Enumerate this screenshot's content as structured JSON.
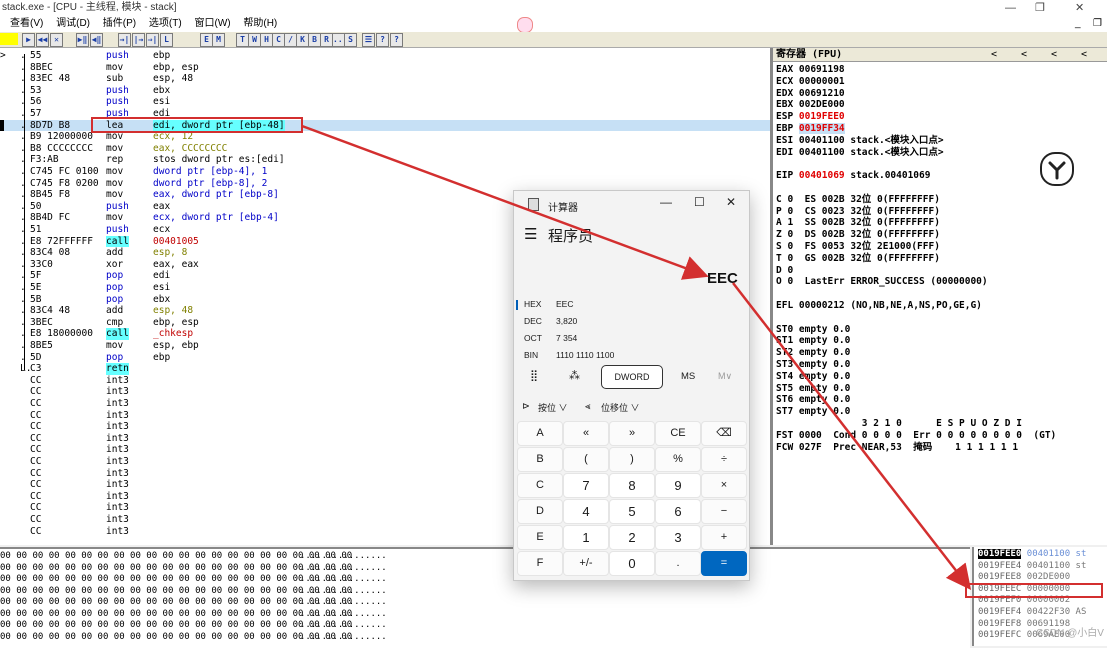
{
  "window": {
    "title": "stack.exe - [CPU - 主线程, 模块 - stack]",
    "controls": [
      "—",
      "❐",
      "✕"
    ],
    "inner_controls": [
      "_",
      "❐"
    ]
  },
  "menu": [
    "查看(V)",
    "调试(D)",
    "插件(P)",
    "选项(T)",
    "窗口(W)",
    "帮助(H)"
  ],
  "toolbar": {
    "buttons": [
      "▶",
      "◀◀",
      "✕",
      "▶‖",
      "◀‖",
      "→|",
      "|→",
      "⇒|",
      "L",
      "E",
      "M",
      "T",
      "W",
      "H",
      "C",
      "/",
      "K",
      "B",
      "R",
      "...",
      "S",
      "☰",
      "?",
      "?"
    ]
  },
  "disasm": [
    {
      "addr": ">",
      "dot": ".",
      "hex": "55",
      "mn": "push",
      "op": "ebp"
    },
    {
      "addr": "",
      "dot": ".",
      "hex": "8BEC",
      "mn": "mov",
      "op": "ebp, esp"
    },
    {
      "addr": "",
      "dot": ".",
      "hex": "83EC 48",
      "mn": "sub",
      "op": "esp, 48"
    },
    {
      "addr": "",
      "dot": ".",
      "hex": "53",
      "mn": "push",
      "op": "ebx"
    },
    {
      "addr": "",
      "dot": ".",
      "hex": "56",
      "mn": "push",
      "op": "esi"
    },
    {
      "addr": "",
      "dot": ".",
      "hex": "57",
      "mn": "push",
      "op": "edi"
    },
    {
      "addr": "",
      "dot": ".",
      "hex": "8D7D B8",
      "mn": "lea",
      "op": "edi, dword ptr [ebp-48]"
    },
    {
      "addr": "",
      "dot": ".",
      "hex": "B9 12000000",
      "mn": "mov",
      "op": "ecx, 12"
    },
    {
      "addr": "",
      "dot": ".",
      "hex": "B8 CCCCCCCC",
      "mn": "mov",
      "op": "eax, CCCCCCCC"
    },
    {
      "addr": "",
      "dot": ".",
      "hex": "F3:AB",
      "mn": "rep",
      "op": "stos dword ptr es:[edi]"
    },
    {
      "addr": "",
      "dot": ".",
      "hex": "C745 FC 0100",
      "mn": "mov",
      "op": "dword ptr [ebp-4], 1"
    },
    {
      "addr": "",
      "dot": ".",
      "hex": "C745 F8 0200",
      "mn": "mov",
      "op": "dword ptr [ebp-8], 2"
    },
    {
      "addr": "",
      "dot": ".",
      "hex": "8B45 F8",
      "mn": "mov",
      "op": "eax, dword ptr [ebp-8]"
    },
    {
      "addr": "",
      "dot": ".",
      "hex": "50",
      "mn": "push",
      "op": "eax"
    },
    {
      "addr": "",
      "dot": ".",
      "hex": "8B4D FC",
      "mn": "mov",
      "op": "ecx, dword ptr [ebp-4]"
    },
    {
      "addr": "",
      "dot": ".",
      "hex": "51",
      "mn": "push",
      "op": "ecx"
    },
    {
      "addr": "",
      "dot": ".",
      "hex": "E8 72FFFFFF",
      "mn": "call",
      "op": "00401005"
    },
    {
      "addr": "",
      "dot": ".",
      "hex": "83C4 08",
      "mn": "add",
      "op": "esp, 8"
    },
    {
      "addr": "",
      "dot": ".",
      "hex": "33C0",
      "mn": "xor",
      "op": "eax, eax"
    },
    {
      "addr": "",
      "dot": ".",
      "hex": "5F",
      "mn": "pop",
      "op": "edi"
    },
    {
      "addr": "",
      "dot": ".",
      "hex": "5E",
      "mn": "pop",
      "op": "esi"
    },
    {
      "addr": "",
      "dot": ".",
      "hex": "5B",
      "mn": "pop",
      "op": "ebx"
    },
    {
      "addr": "",
      "dot": ".",
      "hex": "83C4 48",
      "mn": "add",
      "op": "esp, 48"
    },
    {
      "addr": "",
      "dot": ".",
      "hex": "3BEC",
      "mn": "cmp",
      "op": "ebp, esp"
    },
    {
      "addr": "",
      "dot": ".",
      "hex": "E8 18000000",
      "mn": "call",
      "op": "_chkesp"
    },
    {
      "addr": "",
      "dot": ".",
      "hex": "8BE5",
      "mn": "mov",
      "op": "esp, ebp"
    },
    {
      "addr": "",
      "dot": ".",
      "hex": "5D",
      "mn": "pop",
      "op": "ebp"
    },
    {
      "addr": "",
      "dot": "L.",
      "hex": "C3",
      "mn": "retn",
      "op": ""
    },
    {
      "addr": "",
      "dot": "",
      "hex": "CC",
      "mn": "int3",
      "op": ""
    },
    {
      "addr": "",
      "dot": "",
      "hex": "CC",
      "mn": "int3",
      "op": ""
    },
    {
      "addr": "",
      "dot": "",
      "hex": "CC",
      "mn": "int3",
      "op": ""
    },
    {
      "addr": "",
      "dot": "",
      "hex": "CC",
      "mn": "int3",
      "op": ""
    },
    {
      "addr": "",
      "dot": "",
      "hex": "CC",
      "mn": "int3",
      "op": ""
    },
    {
      "addr": "",
      "dot": "",
      "hex": "CC",
      "mn": "int3",
      "op": ""
    },
    {
      "addr": "",
      "dot": "",
      "hex": "CC",
      "mn": "int3",
      "op": ""
    },
    {
      "addr": "",
      "dot": "",
      "hex": "CC",
      "mn": "int3",
      "op": ""
    },
    {
      "addr": "",
      "dot": "",
      "hex": "CC",
      "mn": "int3",
      "op": ""
    },
    {
      "addr": "",
      "dot": "",
      "hex": "CC",
      "mn": "int3",
      "op": ""
    },
    {
      "addr": "",
      "dot": "",
      "hex": "CC",
      "mn": "int3",
      "op": ""
    },
    {
      "addr": "",
      "dot": "",
      "hex": "CC",
      "mn": "int3",
      "op": ""
    },
    {
      "addr": "",
      "dot": "",
      "hex": "CC",
      "mn": "int3",
      "op": ""
    },
    {
      "addr": "",
      "dot": "",
      "hex": "CC",
      "mn": "int3",
      "op": ""
    }
  ],
  "registers": {
    "header": "寄存器 (FPU)",
    "header_arrows": [
      "<",
      "<",
      "<",
      "<"
    ],
    "lines": [
      {
        "t": "EAX 00691198"
      },
      {
        "t": "ECX 00000001"
      },
      {
        "t": "EDX 00691210"
      },
      {
        "t": "EBX 002DE000"
      },
      {
        "t": "ESP ",
        "r": "0019FEE0"
      },
      {
        "t": "EBP ",
        "r": "0019FF34"
      },
      {
        "t": "ESI 00401100 stack.<模块入口点>"
      },
      {
        "t": "EDI 00401100 stack.<模块入口点>"
      },
      {
        "t": ""
      },
      {
        "t": "EIP ",
        "r": "00401069",
        "s": " stack.00401069"
      },
      {
        "t": ""
      },
      {
        "t": "C 0  ES 002B 32位 0(FFFFFFFF)"
      },
      {
        "t": "P 0  CS 0023 32位 0(FFFFFFFF)"
      },
      {
        "t": "A 1  SS 002B 32位 0(FFFFFFFF)"
      },
      {
        "t": "Z 0  DS 002B 32位 0(FFFFFFFF)"
      },
      {
        "t": "S 0  FS 0053 32位 2E1000(FFF)"
      },
      {
        "t": "T 0  GS 002B 32位 0(FFFFFFFF)"
      },
      {
        "t": "D 0"
      },
      {
        "t": "O 0  LastErr ERROR_SUCCESS (00000000)"
      },
      {
        "t": ""
      },
      {
        "t": "EFL 00000212 (NO,NB,NE,A,NS,PO,GE,G)"
      },
      {
        "t": ""
      },
      {
        "t": "ST0 empty 0.0"
      },
      {
        "t": "ST1 empty 0.0"
      },
      {
        "t": "ST2 empty 0.0"
      },
      {
        "t": "ST3 empty 0.0"
      },
      {
        "t": "ST4 empty 0.0"
      },
      {
        "t": "ST5 empty 0.0"
      },
      {
        "t": "ST6 empty 0.0"
      },
      {
        "t": "ST7 empty 0.0"
      },
      {
        "t": "               3 2 1 0      E S P U O Z D I"
      },
      {
        "t": "FST 0000  Cond 0 0 0 0  Err 0 0 0 0 0 0 0 0  (GT)"
      },
      {
        "t": "FCW 027F  Prec NEAR,53  掩码    1 1 1 1 1 1"
      }
    ]
  },
  "dump": {
    "hex": "00 00 00 00 00 00 00 00 00 00 00 00 00 00 00 00 00 00 00 00 00 00",
    "ascii": "................",
    "rows": 8
  },
  "stack": [
    {
      "a": "0019FEE0",
      "v": "00401100 st",
      "top": true
    },
    {
      "a": "0019FEE4",
      "v": "00401100 st"
    },
    {
      "a": "0019FEE8",
      "v": "002DE000"
    },
    {
      "a": "0019FEEC",
      "v": "00000000"
    },
    {
      "a": "0019FEF0",
      "v": "00000002"
    },
    {
      "a": "0019FEF4",
      "v": "00422F30 AS"
    },
    {
      "a": "0019FEF8",
      "v": "00691198"
    },
    {
      "a": "0019FEFC",
      "v": "0069AE00"
    }
  ],
  "calculator": {
    "title": "计算器",
    "mode": "程序员",
    "window_controls": [
      "—",
      "☐",
      "✕"
    ],
    "rows": [
      {
        "label": "HEX",
        "value": "EEC",
        "selected": true
      },
      {
        "label": "DEC",
        "value": "3,820"
      },
      {
        "label": "OCT",
        "value": "7 354"
      },
      {
        "label": "BIN",
        "value": "1110 1110 1100"
      }
    ],
    "word_size": "DWORD",
    "ms": "MS",
    "mv": "M∨",
    "bitwise": "按位",
    "shift": "位移位",
    "keypad": [
      [
        "A",
        "«",
        "»",
        "CE",
        "⌫"
      ],
      [
        "B",
        "(",
        ")",
        "%",
        "÷"
      ],
      [
        "C",
        "7",
        "8",
        "9",
        "×"
      ],
      [
        "D",
        "4",
        "5",
        "6",
        "−"
      ],
      [
        "E",
        "1",
        "2",
        "3",
        "+"
      ],
      [
        "F",
        "+/-",
        "0",
        ".",
        "="
      ]
    ]
  },
  "annotation": {
    "label": "EEC",
    "color": "#d32f2f"
  },
  "watermark": "CSDN @小白V"
}
